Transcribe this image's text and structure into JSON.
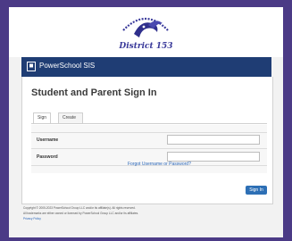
{
  "district": {
    "logo_text": "District 153"
  },
  "topbar": {
    "product": "PowerSchool SIS"
  },
  "signin": {
    "title": "Student and Parent Sign In",
    "tabs": [
      {
        "label": "Sign In",
        "active": true
      },
      {
        "label": "Create Account",
        "active": false
      }
    ],
    "username_label": "Username",
    "password_label": "Password",
    "forgot_link": "Forgot Username or Password?",
    "button": "Sign In"
  },
  "footer": {
    "copyright": "Copyright © 2005-2023 PowerSchool Group LLC and/or its affiliate(s). All rights reserved.",
    "trademarks": "All trademarks are either owned or licensed by PowerSchool Group LLC and/or its affiliates.",
    "privacy": "Privacy Policy"
  },
  "colors": {
    "page_bg": "#4b3a86",
    "topbar": "#1f3d74",
    "button": "#2d6fb5",
    "link": "#2a66b8"
  }
}
